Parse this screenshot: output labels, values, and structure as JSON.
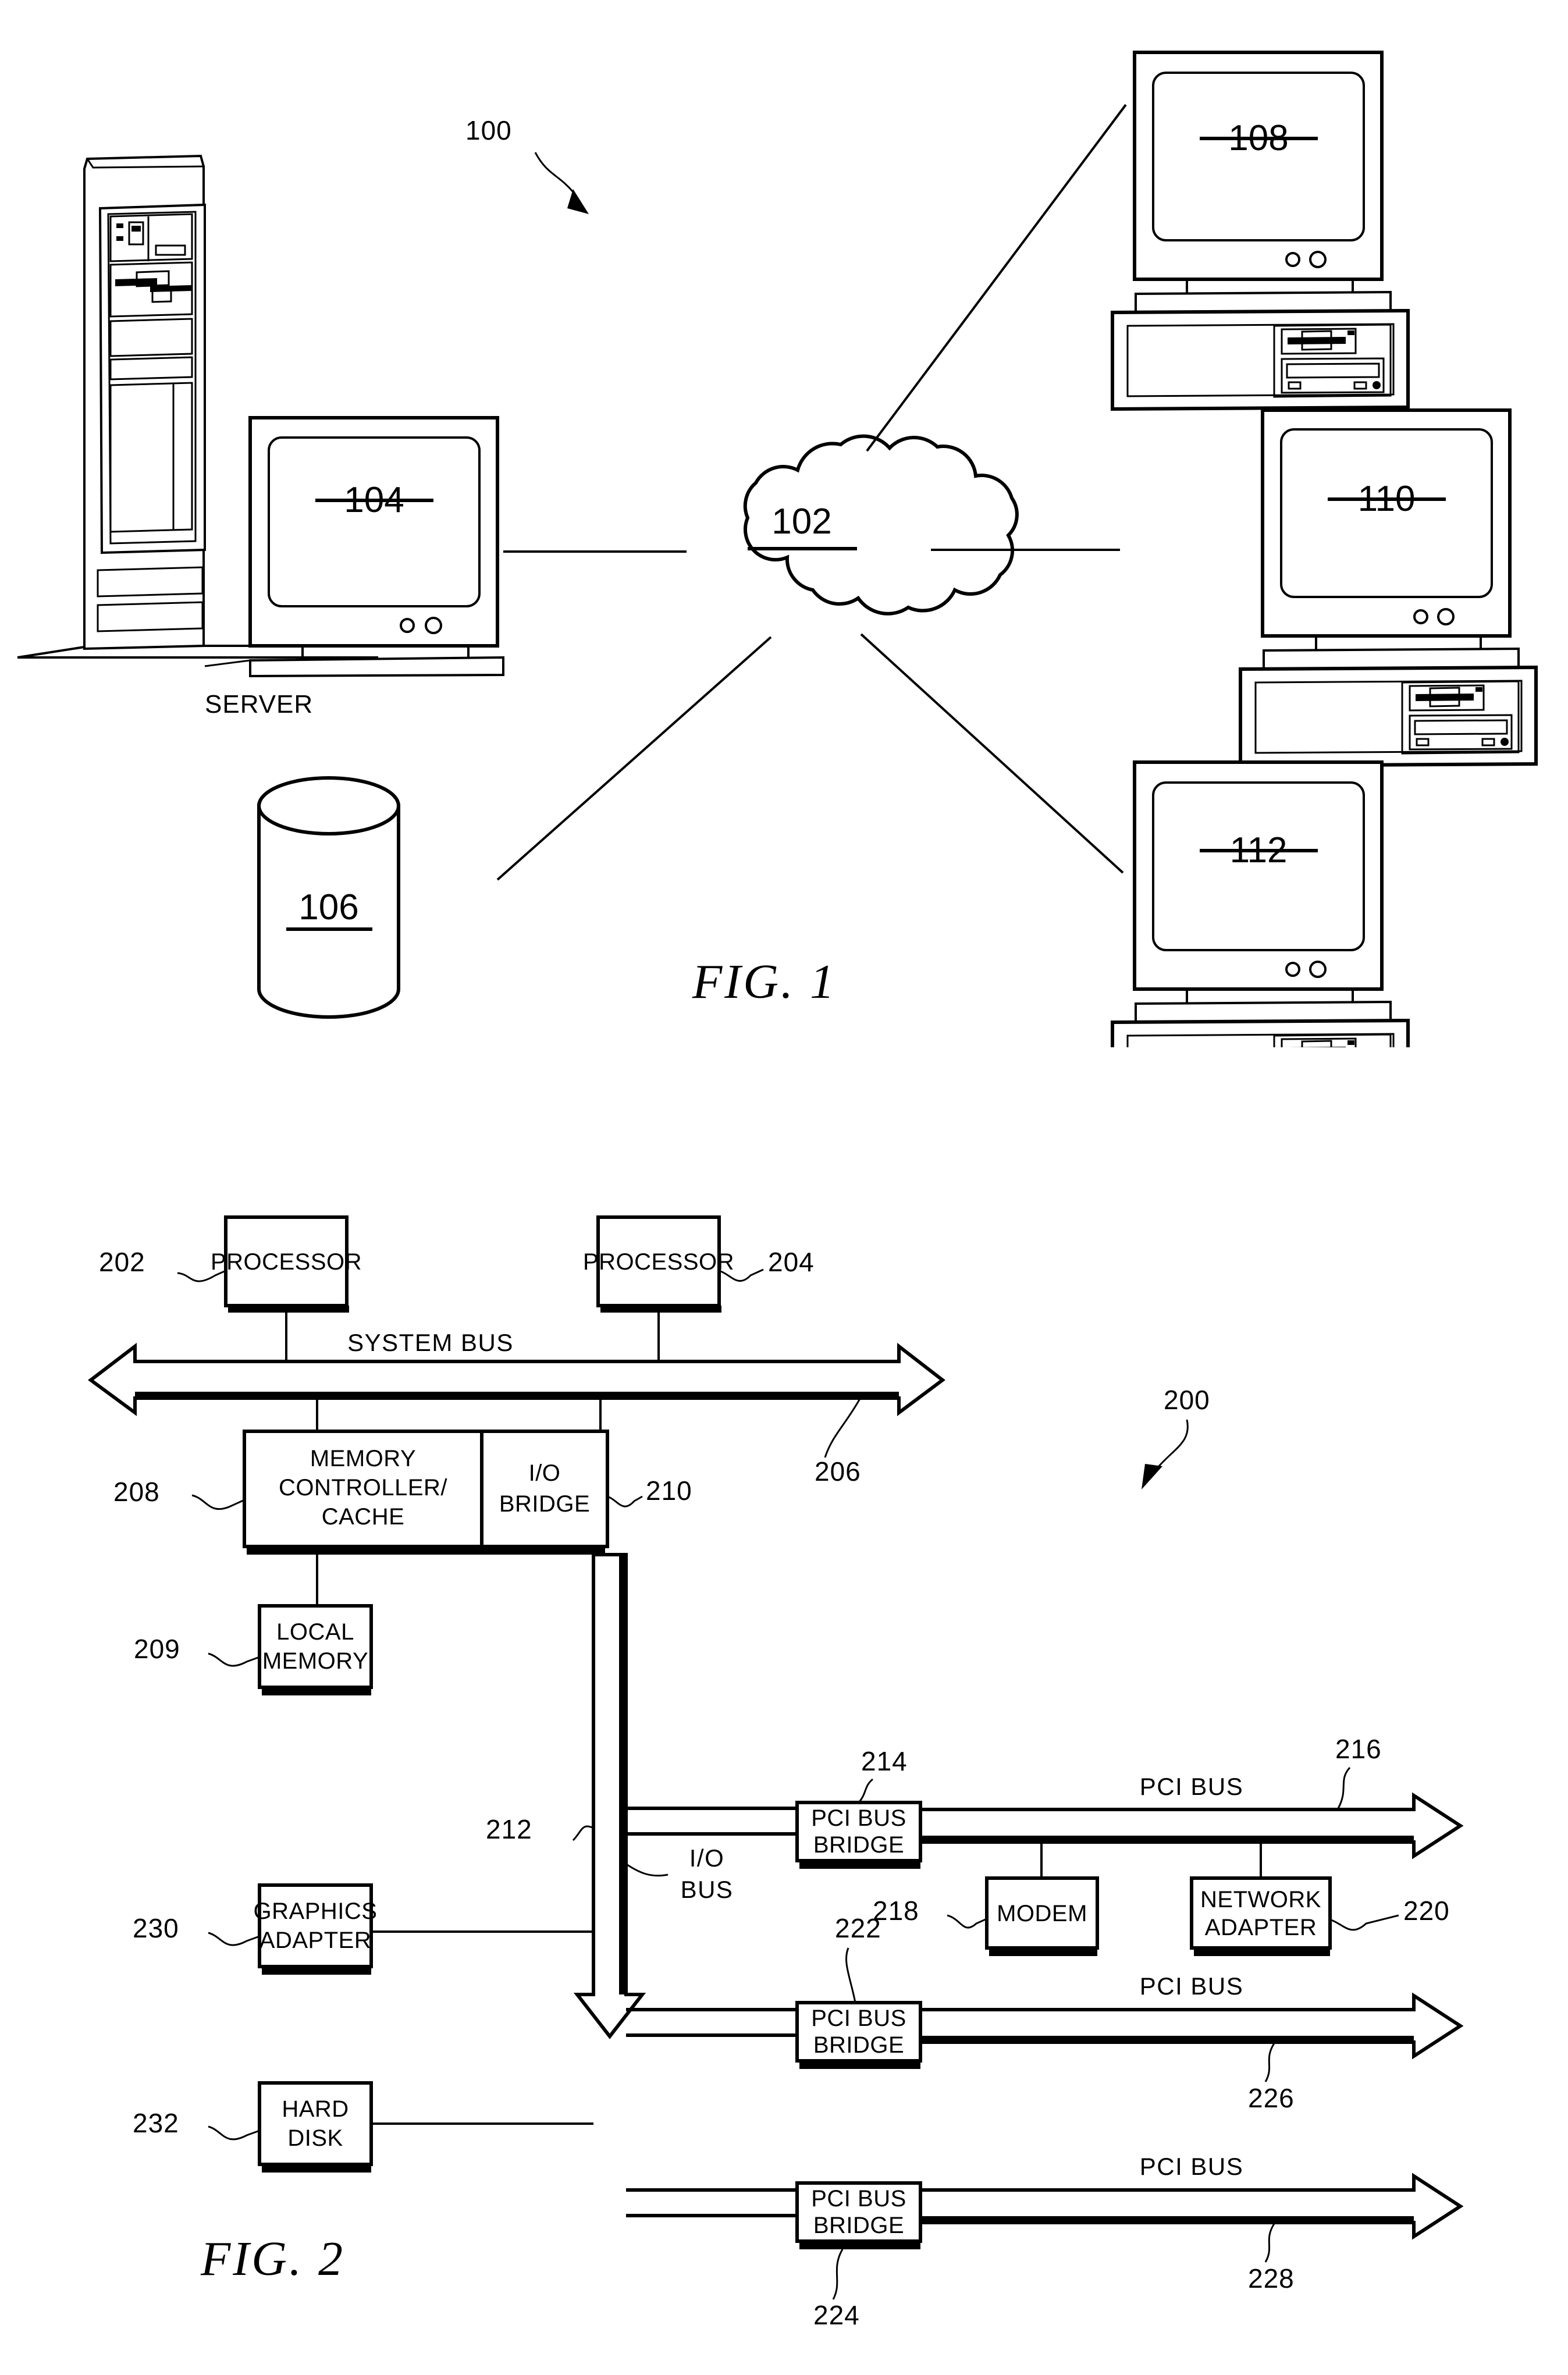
{
  "document": {
    "type": "patent-drawing-sheet",
    "figures": [
      {
        "caption": "FIG.  1"
      },
      {
        "caption": "FIG.  2"
      }
    ]
  },
  "fig1": {
    "caption": "FIG.  1",
    "system_ref": "100",
    "network_cloud": {
      "ref": "102",
      "shape": "cloud"
    },
    "server": {
      "monitor_ref": "104",
      "label": "SERVER",
      "tower": "server-tower"
    },
    "storage": {
      "ref": "106",
      "shape": "cylinder"
    },
    "clients": [
      {
        "ref": "108"
      },
      {
        "ref": "110"
      },
      {
        "ref": "112"
      }
    ]
  },
  "fig2": {
    "caption": "FIG.  2",
    "system_ref": "200",
    "blocks": [
      {
        "ref": "202",
        "label": "PROCESSOR"
      },
      {
        "ref": "204",
        "label": "PROCESSOR"
      },
      {
        "ref": "208",
        "label": "MEMORY\nCONTROLLER/\nCACHE",
        "lines": [
          "MEMORY",
          "CONTROLLER/",
          "CACHE"
        ]
      },
      {
        "ref": "210",
        "label": "I/O BRIDGE",
        "lines": [
          "I/O",
          "BRIDGE"
        ]
      },
      {
        "ref": "209",
        "label": "LOCAL MEMORY",
        "lines": [
          "LOCAL",
          "MEMORY"
        ]
      },
      {
        "ref": "214",
        "label": "PCI BUS BRIDGE",
        "lines": [
          "PCI  BUS",
          "BRIDGE"
        ]
      },
      {
        "ref": "218",
        "label": "MODEM",
        "lines": [
          "MODEM"
        ]
      },
      {
        "ref": "220",
        "label": "NETWORK ADAPTER",
        "lines": [
          "NETWORK",
          "ADAPTER"
        ]
      },
      {
        "ref": "222",
        "label": "PCI BUS BRIDGE",
        "lines": [
          "PCI  BUS",
          "BRIDGE"
        ]
      },
      {
        "ref": "224",
        "label": "PCI BUS BRIDGE",
        "lines": [
          "PCI  BUS",
          "BRIDGE"
        ]
      },
      {
        "ref": "230",
        "label": "GRAPHICS ADAPTER",
        "lines": [
          "GRAPHICS",
          "ADAPTER"
        ]
      },
      {
        "ref": "232",
        "label": "HARD DISK",
        "lines": [
          "HARD",
          "DISK"
        ]
      }
    ],
    "buses": [
      {
        "ref": "206",
        "label": "SYSTEM  BUS",
        "orientation": "horizontal-double-arrow"
      },
      {
        "ref": "212",
        "label": "I/O BUS",
        "lines": [
          "I/O",
          "BUS"
        ],
        "orientation": "vertical-down-arrow"
      },
      {
        "ref": "216",
        "label": "PCI  BUS",
        "orientation": "horizontal-right-arrow"
      },
      {
        "ref": "226",
        "label": "PCI  BUS",
        "orientation": "horizontal-right-arrow"
      },
      {
        "ref": "228",
        "label": "PCI  BUS",
        "orientation": "horizontal-right-arrow"
      }
    ],
    "labels": {
      "processor_1": "PROCESSOR",
      "processor_2": "PROCESSOR",
      "system_bus": "SYSTEM  BUS",
      "memory_controller_l1": "MEMORY",
      "memory_controller_l2": "CONTROLLER/",
      "memory_controller_l3": "CACHE",
      "io_bridge_l1": "I/O",
      "io_bridge_l2": "BRIDGE",
      "local_memory_l1": "LOCAL",
      "local_memory_l2": "MEMORY",
      "graphics_adapter_l1": "GRAPHICS",
      "graphics_adapter_l2": "ADAPTER",
      "hard_disk_l1": "HARD",
      "hard_disk_l2": "DISK",
      "pci_bus_bridge_l1": "PCI  BUS",
      "pci_bus_bridge_l2": "BRIDGE",
      "modem": "MODEM",
      "network_adapter_l1": "NETWORK",
      "network_adapter_l2": "ADAPTER",
      "io_bus_l1": "I/O",
      "io_bus_l2": "BUS",
      "pci_bus": "PCI  BUS"
    },
    "refs": {
      "r200": "200",
      "r202": "202",
      "r204": "204",
      "r206": "206",
      "r208": "208",
      "r209": "209",
      "r210": "210",
      "r212": "212",
      "r214": "214",
      "r216": "216",
      "r218": "218",
      "r220": "220",
      "r222": "222",
      "r224": "224",
      "r226": "226",
      "r228": "228",
      "r230": "230",
      "r232": "232"
    }
  },
  "colors": {
    "ink": "#000000",
    "paper": "#ffffff"
  }
}
